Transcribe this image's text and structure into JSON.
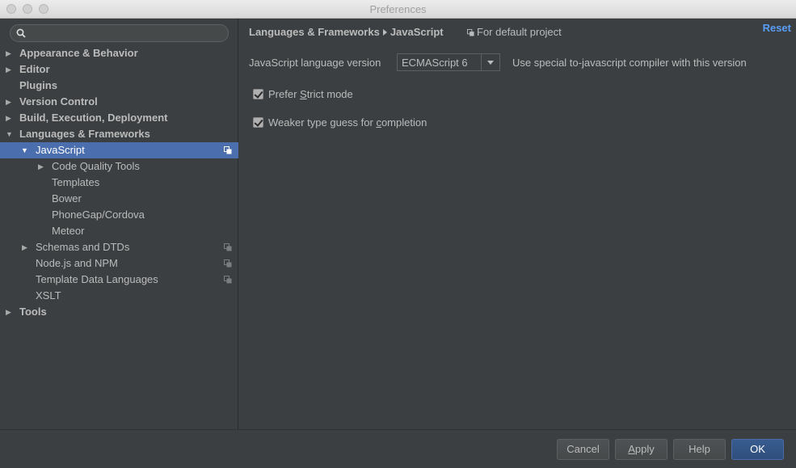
{
  "window": {
    "title": "Preferences"
  },
  "search": {
    "placeholder": ""
  },
  "sidebar": {
    "items": [
      {
        "label": "Appearance & Behavior",
        "arrow": "▶"
      },
      {
        "label": "Editor",
        "arrow": "▶"
      },
      {
        "label": "Plugins",
        "arrow": ""
      },
      {
        "label": "Version Control",
        "arrow": "▶"
      },
      {
        "label": "Build, Execution, Deployment",
        "arrow": "▶"
      },
      {
        "label": "Languages & Frameworks",
        "arrow": "▼"
      },
      {
        "label": "JavaScript",
        "arrow": "▼"
      },
      {
        "label": "Code Quality Tools",
        "arrow": "▶"
      },
      {
        "label": "Templates",
        "arrow": ""
      },
      {
        "label": "Bower",
        "arrow": ""
      },
      {
        "label": "PhoneGap/Cordova",
        "arrow": ""
      },
      {
        "label": "Meteor",
        "arrow": ""
      },
      {
        "label": "Schemas and DTDs",
        "arrow": "▶"
      },
      {
        "label": "Node.js and NPM",
        "arrow": ""
      },
      {
        "label": "Template Data Languages",
        "arrow": ""
      },
      {
        "label": "XSLT",
        "arrow": ""
      },
      {
        "label": "Tools",
        "arrow": "▶"
      }
    ]
  },
  "main": {
    "breadcrumb": {
      "parent": "Languages & Frameworks",
      "current": "JavaScript"
    },
    "scope_label": "For default project",
    "reset_label": "Reset",
    "language_version_label": "JavaScript language version",
    "language_version_value": "ECMAScript 6",
    "compiler_note": "Use special to-javascript compiler with this version",
    "prefer_strict": {
      "label_pre": "Prefer ",
      "label_mn": "S",
      "label_post": "trict mode",
      "checked": true
    },
    "weaker_type": {
      "label_pre": "Weaker type guess for ",
      "label_mn": "c",
      "label_post": "ompletion",
      "checked": true
    }
  },
  "footer": {
    "cancel": "Cancel",
    "apply_mn": "A",
    "apply_rest": "pply",
    "help": "Help",
    "ok": "OK"
  },
  "colors": {
    "selection": "#4b6eaf",
    "link": "#589df6",
    "background": "#3c3f41"
  }
}
